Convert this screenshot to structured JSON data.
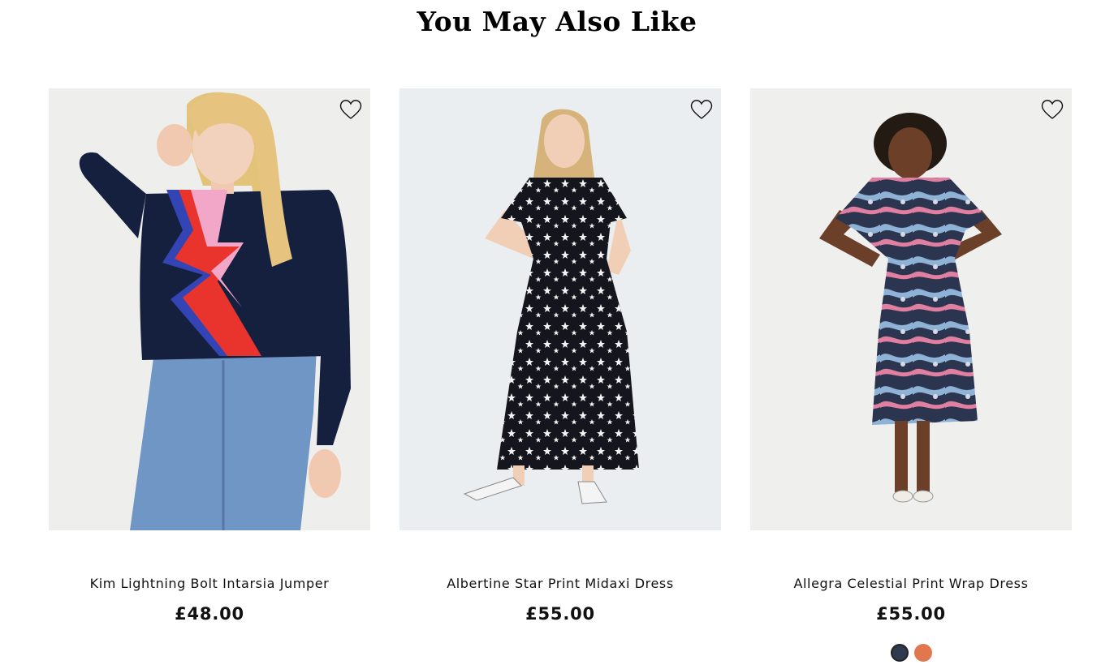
{
  "section": {
    "title": "You May Also Like"
  },
  "products": [
    {
      "name": "Kim Lightning Bolt Intarsia Jumper",
      "price": "£48.00",
      "wishlist_icon": "heart-outline-icon",
      "swatches": []
    },
    {
      "name": "Albertine Star Print Midaxi Dress",
      "price": "£55.00",
      "wishlist_icon": "heart-outline-icon",
      "swatches": []
    },
    {
      "name": "Allegra Celestial Print Wrap Dress",
      "price": "£55.00",
      "wishlist_icon": "heart-outline-icon",
      "swatches": [
        {
          "color": "#2f3a4f",
          "selected": true
        },
        {
          "color": "#e0774f",
          "selected": false
        }
      ]
    }
  ],
  "colors": {
    "navy": "#14213d",
    "bolt_red": "#e8342c",
    "bolt_pink": "#f2a7c9",
    "bolt_blue": "#3344b5",
    "denim": "#6f95c4"
  }
}
